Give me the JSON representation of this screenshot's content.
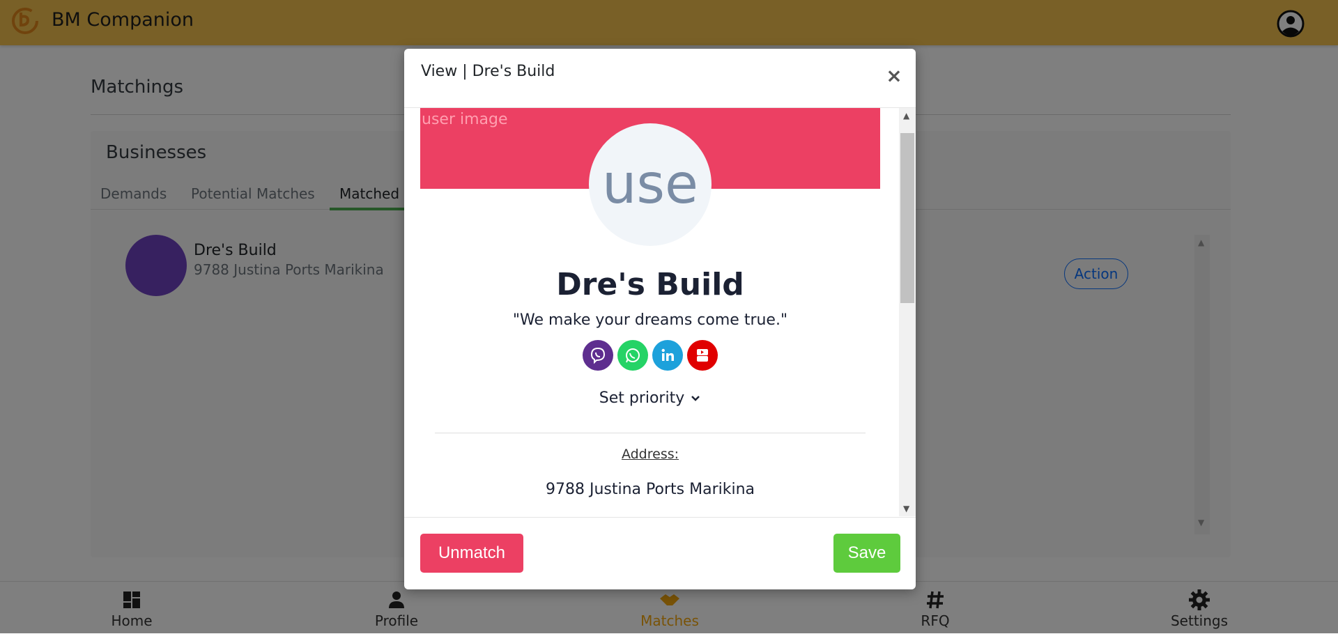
{
  "app": {
    "title": "BM Companion"
  },
  "page": {
    "title": "Matchings",
    "card_title": "Businesses",
    "tabs": [
      {
        "label": "Demands"
      },
      {
        "label": "Potential Matches"
      },
      {
        "label": "Matched"
      }
    ],
    "list": [
      {
        "name": "Dre's Build",
        "address": "9788 Justina Ports Marikina",
        "action_label": "Action"
      }
    ]
  },
  "nav": {
    "items": [
      {
        "label": "Home",
        "icon": "dashboard-icon"
      },
      {
        "label": "Profile",
        "icon": "person-icon"
      },
      {
        "label": "Matches",
        "icon": "handshake-icon",
        "active": true
      },
      {
        "label": "RFQ",
        "icon": "hash-icon"
      },
      {
        "label": "Settings",
        "icon": "gear-icon"
      }
    ]
  },
  "modal": {
    "title": "View | Dre's Build",
    "close_glyph": "×",
    "broken_image_alt": "user image",
    "profile_placeholder": "use",
    "business_name": "Dre's Build",
    "tagline": "\"We make your dreams come true.\"",
    "socials": [
      {
        "name": "viber-icon",
        "color": "#5e2e8f"
      },
      {
        "name": "whatsapp-icon",
        "color": "#25d366"
      },
      {
        "name": "linkedin-icon",
        "color": "#1da1db"
      },
      {
        "name": "youtube-icon",
        "color": "#e00000"
      }
    ],
    "priority_label": "Set priority",
    "address_label": "Address:",
    "address_value": "9788 Justina Ports Marikina",
    "unmatch_label": "Unmatch",
    "save_label": "Save"
  },
  "colors": {
    "topbar": "#f2c14e",
    "banner": "#ec4063",
    "unmatch": "#ec4063",
    "save": "#5ecb3d",
    "active_tab": "#4caf50",
    "active_nav": "#f2a60f",
    "avatar": "#6f42c1",
    "action": "#0d6efd"
  }
}
